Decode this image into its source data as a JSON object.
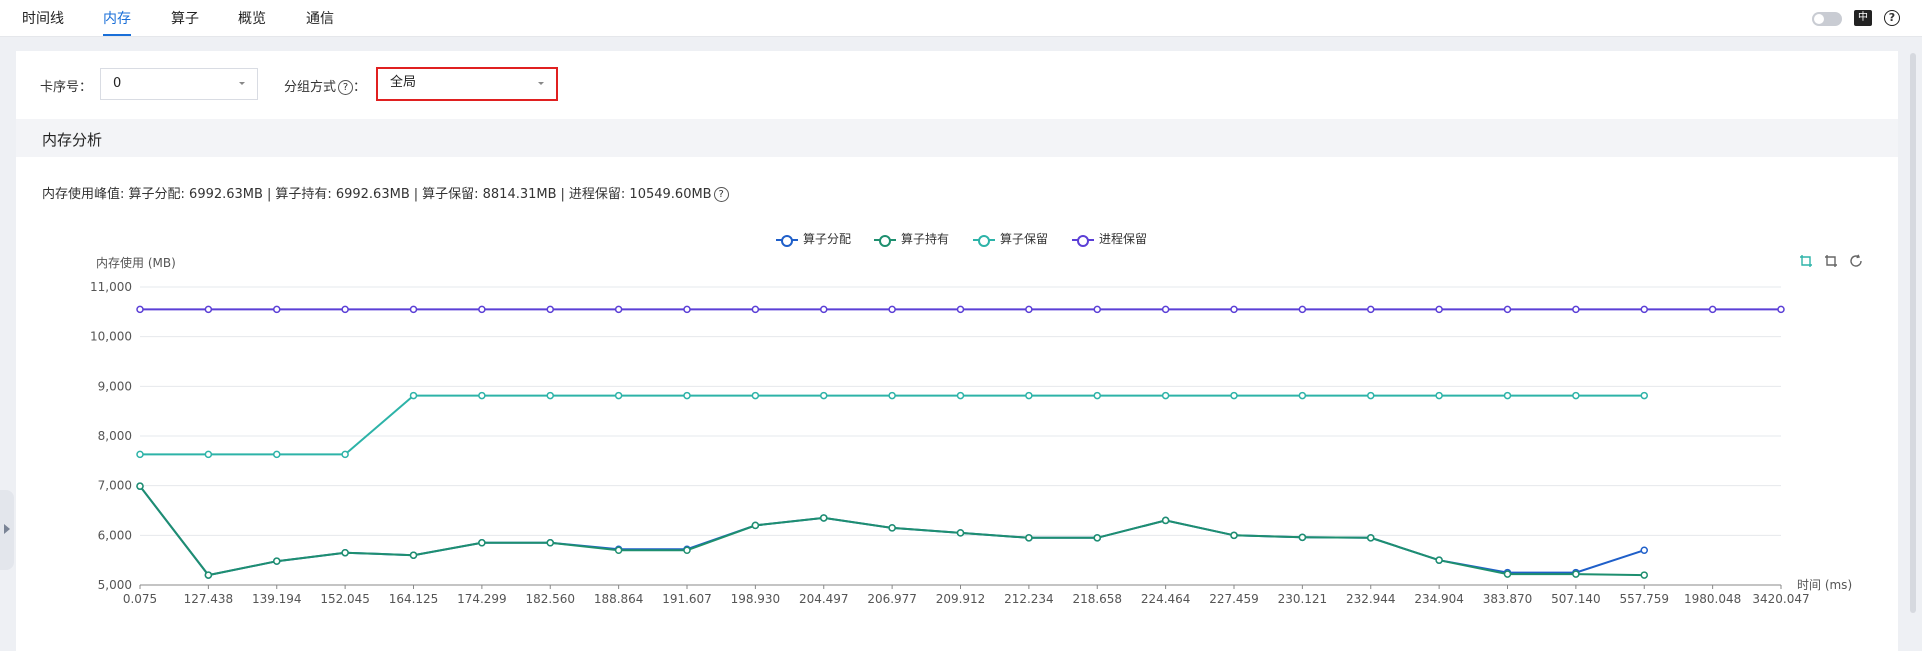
{
  "tabs": [
    {
      "label": "时间线",
      "active": false
    },
    {
      "label": "内存",
      "active": true
    },
    {
      "label": "算子",
      "active": false
    },
    {
      "label": "概览",
      "active": false
    },
    {
      "label": "通信",
      "active": false
    }
  ],
  "header_icons": [
    "theme-toggle",
    "language-icon",
    "help-icon"
  ],
  "language_icon_text": "中",
  "filters": {
    "card_label": "卡序号：",
    "card_value": "0",
    "group_label": "分组方式",
    "group_colon": "：",
    "group_value": "全局"
  },
  "section_title": "内存分析",
  "peak_info": {
    "prefix": "内存使用峰值:",
    "items": [
      "算子分配: 6992.63MB",
      "算子持有: 6992.63MB",
      "算子保留: 8814.31MB",
      "进程保留: 10549.60MB"
    ],
    "separator": "|"
  },
  "toolbox_icons": [
    "zoom-select-icon",
    "zoom-reset-icon",
    "restore-icon"
  ],
  "chart_data": {
    "type": "line",
    "ylabel": "内存使用 (MB)",
    "xlabel": "时间 (ms)",
    "ylim": [
      5000,
      11000
    ],
    "yticks": [
      5000,
      6000,
      7000,
      8000,
      9000,
      10000,
      11000
    ],
    "legend_position": "top-center",
    "grid": true,
    "x_categories": [
      "0.075",
      "127.438",
      "139.194",
      "152.045",
      "164.125",
      "174.299",
      "182.560",
      "188.864",
      "191.607",
      "198.930",
      "204.497",
      "206.977",
      "209.912",
      "212.234",
      "218.658",
      "224.464",
      "227.459",
      "230.121",
      "232.944",
      "234.904",
      "383.870",
      "507.140",
      "557.759",
      "1980.048",
      "3420.047"
    ],
    "series": [
      {
        "name": "算子分配",
        "color": "#1f5fc9",
        "values": [
          6990,
          5200,
          5480,
          5650,
          5600,
          5850,
          5850,
          5720,
          5720,
          6200,
          6350,
          6150,
          6050,
          5950,
          5950,
          6300,
          6000,
          5960,
          5950,
          5500,
          5250,
          5250,
          5700,
          null,
          null
        ]
      },
      {
        "name": "算子持有",
        "color": "#1e8f6f",
        "values": [
          6990,
          5200,
          5480,
          5650,
          5600,
          5850,
          5850,
          5700,
          5700,
          6200,
          6350,
          6150,
          6050,
          5950,
          5950,
          6300,
          6000,
          5960,
          5950,
          5500,
          5220,
          5220,
          5200,
          null,
          null
        ]
      },
      {
        "name": "算子保留",
        "color": "#2db3a8",
        "values": [
          7630,
          7630,
          7630,
          7630,
          8814,
          8814,
          8814,
          8814,
          8814,
          8814,
          8814,
          8814,
          8814,
          8814,
          8814,
          8814,
          8814,
          8814,
          8814,
          8814,
          8814,
          8814,
          8814,
          null,
          null
        ]
      },
      {
        "name": "进程保留",
        "color": "#5b3fd6",
        "values": [
          10549.6,
          10549.6,
          10549.6,
          10549.6,
          10549.6,
          10549.6,
          10549.6,
          10549.6,
          10549.6,
          10549.6,
          10549.6,
          10549.6,
          10549.6,
          10549.6,
          10549.6,
          10549.6,
          10549.6,
          10549.6,
          10549.6,
          10549.6,
          10549.6,
          10549.6,
          10549.6,
          10549.6,
          10549.6
        ]
      }
    ]
  }
}
